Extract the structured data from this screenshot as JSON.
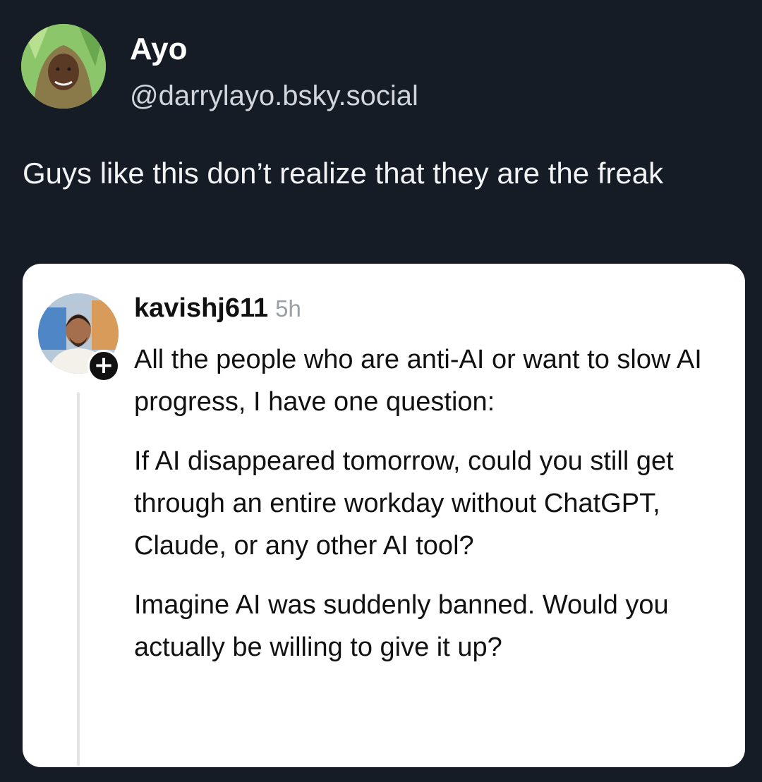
{
  "post": {
    "author_name": "Ayo",
    "author_handle": "@darrylayo.bsky.social",
    "text": "Guys like this don’t realize that they are the freak"
  },
  "quoted": {
    "username": "kavishj611",
    "time": "5h",
    "follow_badge": "+",
    "paragraphs": [
      "All the people who are anti-AI or want to slow AI progress, I have one question:",
      "If AI disappeared tomorrow, could you still get through an entire workday without ChatGPT, Claude, or any other AI tool?",
      "Imagine AI was suddenly banned. Would you actually be willing to give it up?"
    ]
  },
  "colors": {
    "background": "#161c26",
    "card": "#ffffff",
    "primary_text_dark": "#f2f3f5",
    "primary_text_light": "#111111",
    "muted": "#9aa0a6"
  }
}
